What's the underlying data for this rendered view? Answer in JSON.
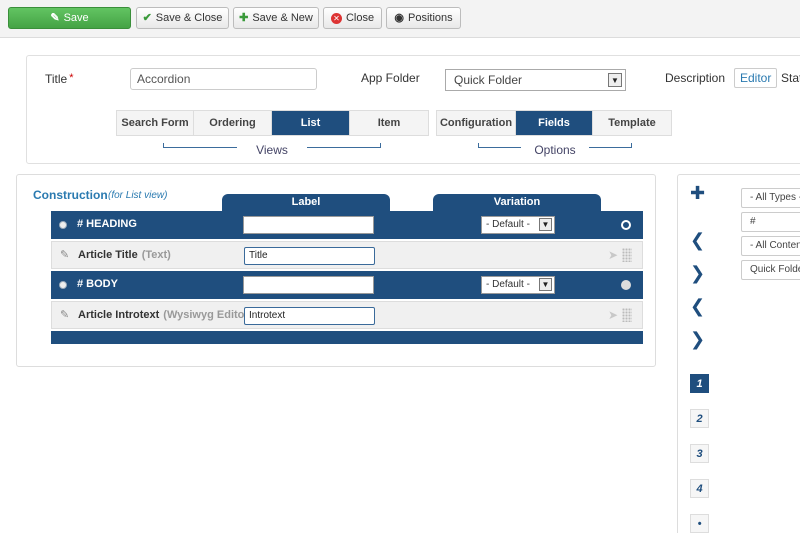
{
  "toolbar": {
    "save": "Save",
    "save_close": "Save & Close",
    "save_new": "Save & New",
    "close": "Close",
    "positions": "Positions"
  },
  "form": {
    "title_label": "Title",
    "required_mark": "*",
    "title_value": "Accordion",
    "app_folder_label": "App Folder",
    "app_folder_value": "Quick Folder",
    "description_label": "Description",
    "editor_button": "Editor",
    "status_label": "Stat"
  },
  "views_tabs": {
    "items": [
      "Search Form",
      "Ordering",
      "List",
      "Item"
    ],
    "active": "List",
    "caption": "Views"
  },
  "options_tabs": {
    "items": [
      "Configuration",
      "Fields",
      "Template"
    ],
    "active": "Fields",
    "caption": "Options"
  },
  "construction": {
    "title": "Construction",
    "subtitle": "(for List view)",
    "col_label": "Label",
    "col_variation": "Variation",
    "rows": [
      {
        "kind": "heading",
        "name": "# HEADING",
        "label_value": "",
        "variation": "- Default -"
      },
      {
        "kind": "field",
        "name": "Article Title",
        "type": "(Text)",
        "label_value": "Title"
      },
      {
        "kind": "heading",
        "name": "# BODY",
        "label_value": "",
        "variation": "- Default -"
      },
      {
        "kind": "field",
        "name": "Article Introtext",
        "type": "(Wysiwyg Editor)",
        "label_value": "Introtext"
      }
    ]
  },
  "side": {
    "numbers": [
      "1",
      "2",
      "3",
      "4",
      "•"
    ],
    "active_number": "1",
    "filters": [
      "- All Types -",
      "#",
      "- All Content",
      "Quick Folder"
    ]
  },
  "colors": {
    "primary": "#1f4e7e",
    "save_green": "#45a345",
    "link_blue": "#2a7ab0"
  }
}
